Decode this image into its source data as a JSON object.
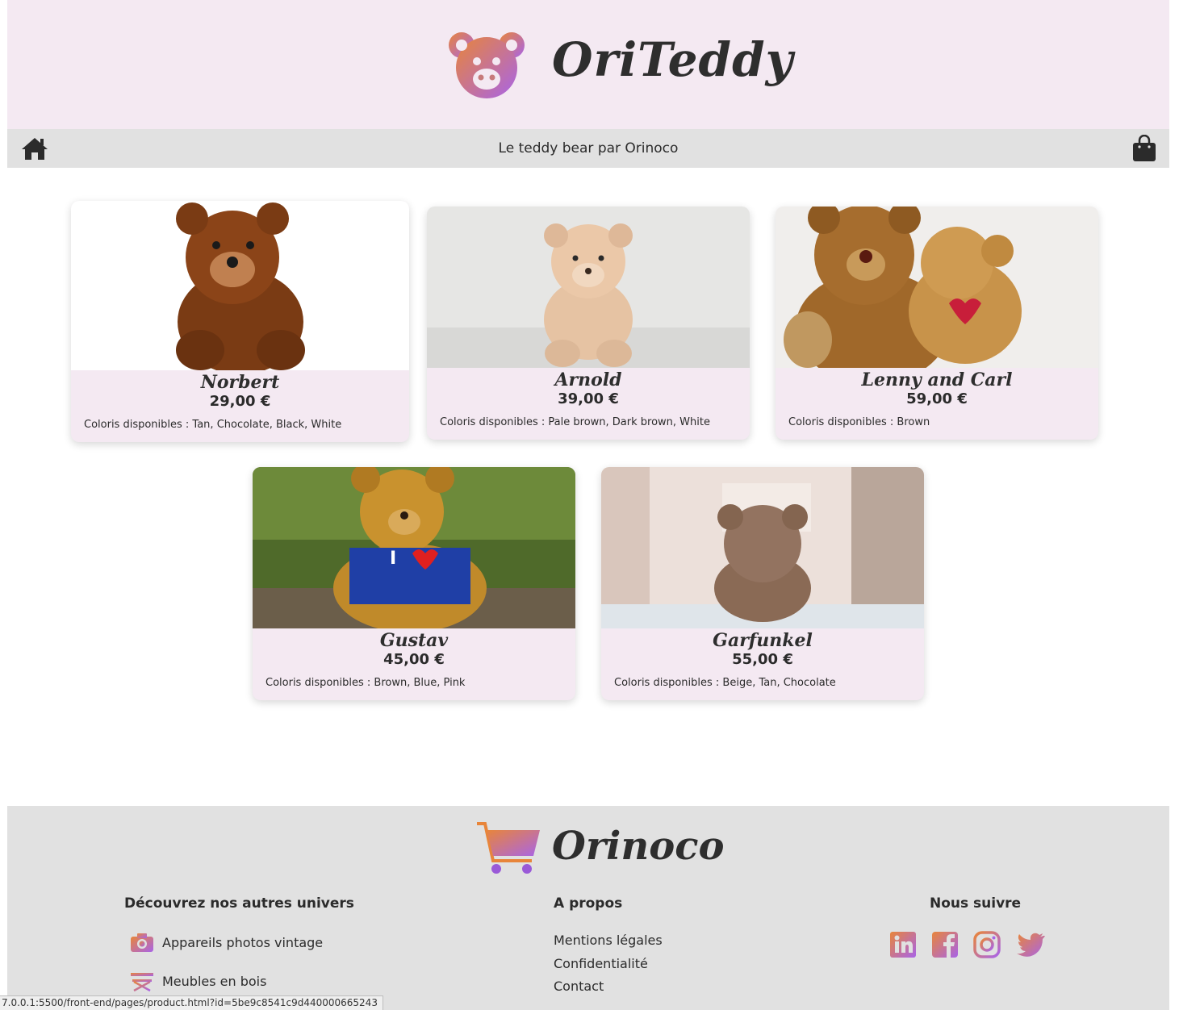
{
  "header": {
    "brand": "OriTeddy",
    "logo_icon": "teddy-bear-face-icon"
  },
  "navbar": {
    "tagline": "Le teddy bear par Orinoco",
    "home_icon": "home-icon",
    "cart_icon": "shopping-bag-icon"
  },
  "products": [
    {
      "name": "Norbert",
      "price": "29,00 €",
      "colors": "Coloris disponibles : Tan, Chocolate, Black, White"
    },
    {
      "name": "Arnold",
      "price": "39,00 €",
      "colors": "Coloris disponibles : Pale brown, Dark brown, White"
    },
    {
      "name": "Lenny and Carl",
      "price": "59,00 €",
      "colors": "Coloris disponibles : Brown"
    },
    {
      "name": "Gustav",
      "price": "45,00 €",
      "colors": "Coloris disponibles : Brown, Blue, Pink"
    },
    {
      "name": "Garfunkel",
      "price": "55,00 €",
      "colors": "Coloris disponibles : Beige, Tan, Chocolate"
    }
  ],
  "footer": {
    "brand": "Orinoco",
    "universes": {
      "title": "Découvrez nos autres univers",
      "items": [
        {
          "label": "Appareils photos vintage",
          "icon": "camera-icon"
        },
        {
          "label": "Meubles en bois",
          "icon": "chair-icon"
        }
      ]
    },
    "about": {
      "title": "A propos",
      "links": [
        "Mentions légales",
        "Confidentialité",
        "Contact"
      ]
    },
    "social": {
      "title": "Nous suivre",
      "icons": [
        "linkedin-icon",
        "facebook-icon",
        "instagram-icon",
        "twitter-icon"
      ]
    }
  },
  "statusbar": {
    "url": "7.0.0.1:5500/front-end/pages/product.html?id=5be9c8541c9d440000665243"
  },
  "colors": {
    "header_bg": "#f4e9f2",
    "nav_bg": "#e1e1e1",
    "gradient_start": "#e8853a",
    "gradient_end": "#a864e8"
  }
}
